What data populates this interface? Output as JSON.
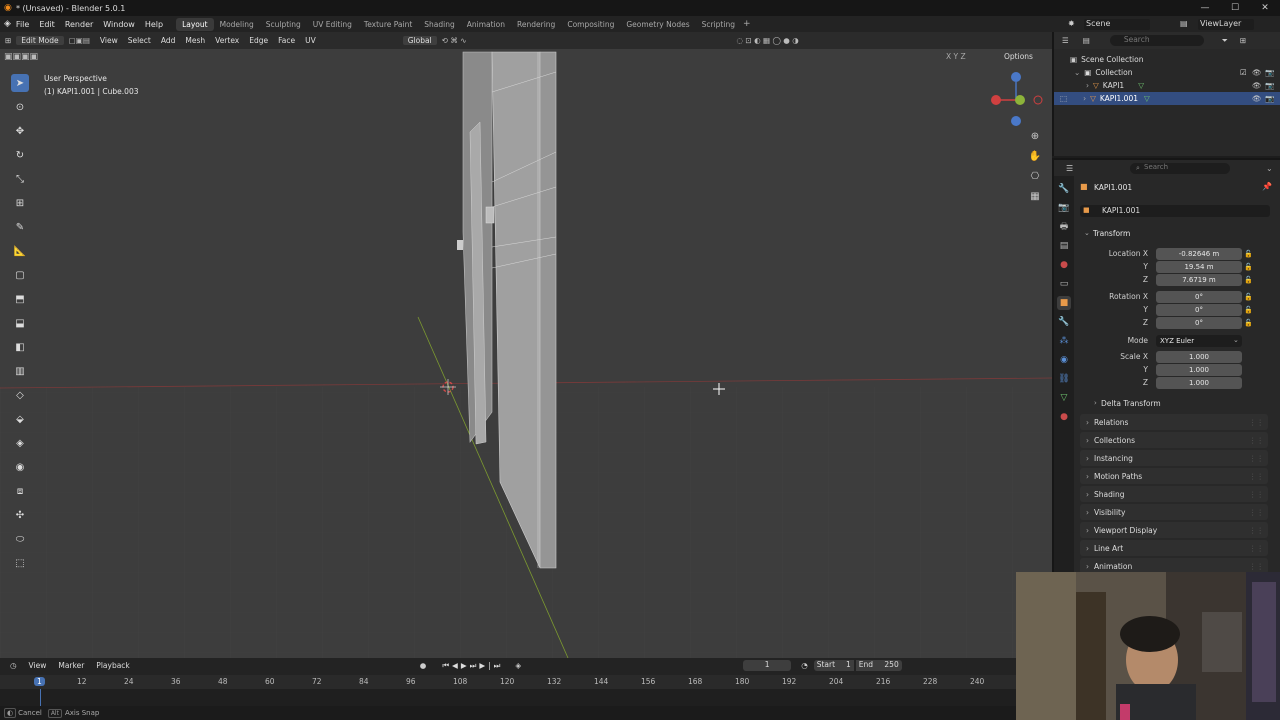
{
  "window": {
    "title": "* (Unsaved) - Blender 5.0.1",
    "min": "—",
    "max": "☐",
    "close": "✕"
  },
  "menu": [
    "File",
    "Edit",
    "Render",
    "Window",
    "Help"
  ],
  "workspaces": [
    "Layout",
    "Modeling",
    "Sculpting",
    "UV Editing",
    "Texture Paint",
    "Shading",
    "Animation",
    "Rendering",
    "Compositing",
    "Geometry Nodes",
    "Scripting"
  ],
  "workspace_add": "+",
  "scene": {
    "label": "Scene",
    "viewlayer": "ViewLayer"
  },
  "vp_header": {
    "mode": "Edit Mode",
    "view": "View",
    "select": "Select",
    "add": "Add",
    "mesh": "Mesh",
    "vertex": "Vertex",
    "edge": "Edge",
    "face": "Face",
    "uv": "UV",
    "orientation": "Global",
    "options": "Options",
    "axes": "X Y Z"
  },
  "vp_overlay": {
    "perspective": "User Perspective",
    "object": "(1) KAPI1.001 | Cube.003"
  },
  "outliner": {
    "search": "Search",
    "root": "Scene Collection",
    "collection": "Collection",
    "items": [
      "KAPI1",
      "KAPI1.001"
    ]
  },
  "properties": {
    "search": "Search",
    "object_name": "KAPI1.001",
    "data_name": "KAPI1.001",
    "transform": "Transform",
    "location_label": "Location X",
    "loc_x": "-0.82646 m",
    "loc_y": "19.54 m",
    "loc_z": "7.6719 m",
    "rotation_label": "Rotation X",
    "rot_x": "0°",
    "rot_y": "0°",
    "rot_z": "0°",
    "mode_label": "Mode",
    "mode": "XYZ Euler",
    "scale_label": "Scale X",
    "scale_x": "1.000",
    "scale_y": "1.000",
    "scale_z": "1.000",
    "y": "Y",
    "z": "Z",
    "delta": "Delta Transform",
    "panels": [
      "Relations",
      "Collections",
      "Instancing",
      "Motion Paths",
      "Shading",
      "Visibility",
      "Viewport Display",
      "Line Art",
      "Animation"
    ]
  },
  "timeline": {
    "view": "View",
    "marker": "Marker",
    "playback": "Playback",
    "current": "1",
    "start_label": "Start",
    "start": "1",
    "end_label": "End",
    "end": "250",
    "ticks": [
      "1",
      "12",
      "24",
      "36",
      "48",
      "60",
      "72",
      "84",
      "96",
      "108",
      "120",
      "132",
      "144",
      "156",
      "168",
      "180",
      "192",
      "204",
      "216",
      "228",
      "240"
    ]
  },
  "status": {
    "cancel": "Cancel",
    "axis_snap": "Axis Snap"
  },
  "colors": {
    "accent": "#4772b3",
    "viewport": "#3d3d3d",
    "xaxis": "#b54545",
    "yaxis": "#8db33a"
  }
}
